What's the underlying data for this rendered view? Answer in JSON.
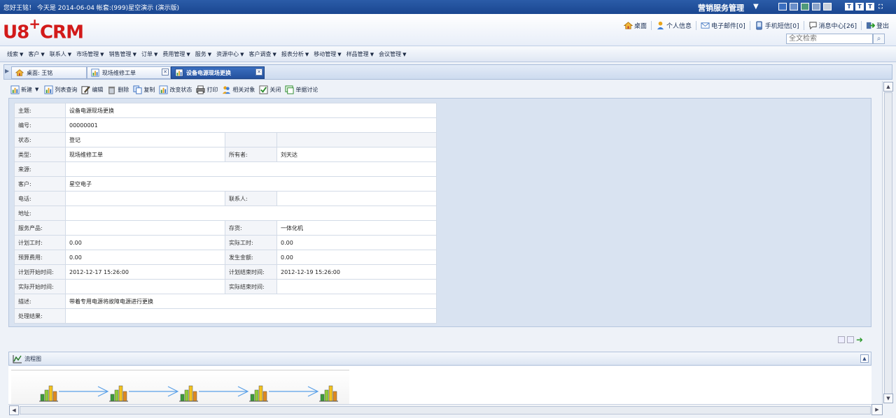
{
  "topbar": {
    "greeting": "您好王铭！  今天是  2014-06-04 帐套:(999)星空演示  (演示版)",
    "system_name": "营销服务管理",
    "font_sizes": [
      "T",
      "T",
      "T"
    ]
  },
  "header": {
    "logo_prefix": "U8",
    "logo_plus": "+",
    "logo_suffix": "CRM",
    "nav": {
      "desktop": "桌面",
      "profile": "个人信息",
      "email": "电子邮件[0]",
      "sms": "手机短信[0]",
      "messages": "消息中心[26]",
      "logout": "登出"
    },
    "search_placeholder": "全文检索"
  },
  "menu": {
    "items": [
      "线索",
      "客户",
      "联系人",
      "市场管理",
      "销售管理",
      "订单",
      "费用管理",
      "服务",
      "资源中心",
      "客户调查",
      "报表分析",
      "移动管理",
      "样品管理",
      "会议管理"
    ]
  },
  "tabs": {
    "home": "桌面: 王铭",
    "repair": "现场维修工单",
    "active": "设备电源现场更换"
  },
  "toolbar": {
    "new": "新建",
    "list_query": "列表查询",
    "edit": "编辑",
    "delete": "删除",
    "copy": "复制",
    "change_status": "改变状态",
    "print": "打印",
    "related": "相关对象",
    "close": "关闭",
    "discuss": "单据讨论"
  },
  "detail": {
    "subject_label": "主题:",
    "subject": "设备电源现场更换",
    "number_label": "编号:",
    "number": "00000001",
    "status_label": "状态:",
    "status": "登记",
    "type_label": "类型:",
    "type": "现场维修工单",
    "owner_label": "所有者:",
    "owner": "刘天达",
    "source_label": "来源:",
    "customer_label": "客户:",
    "customer": "星空电子",
    "phone_label": "电话:",
    "contact_label": "联系人:",
    "address_label": "地址:",
    "product_label": "服务产品:",
    "stock_label": "存货:",
    "stock": "一体化机",
    "plan_hours_label": "计划工时:",
    "plan_hours": "0.00",
    "actual_hours_label": "实际工时:",
    "actual_hours": "0.00",
    "budget_label": "预算费用:",
    "budget": "0.00",
    "incurred_label": "发生金额:",
    "incurred": "0.00",
    "plan_start_label": "计划开始时间:",
    "plan_start": "2012-12-17 15:26:00",
    "plan_end_label": "计划结束时间:",
    "plan_end": "2012-12-19 15:26:00",
    "actual_start_label": "实际开始时间:",
    "actual_end_label": "实际结束时间:",
    "desc_label": "描述:",
    "desc": "带着专用电源将故障电源进行更换",
    "result_label": "处理结果:"
  },
  "flow": {
    "title": "流程图",
    "steps": 5
  }
}
